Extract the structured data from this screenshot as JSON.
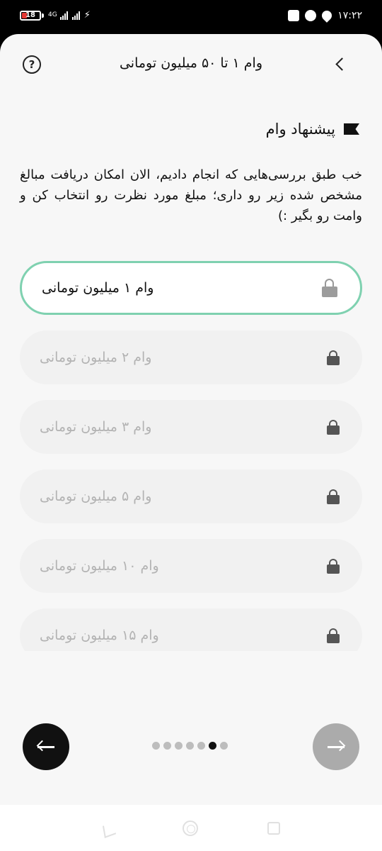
{
  "status_bar": {
    "battery": "18",
    "network": "4G",
    "time": "۱۷:۲۲"
  },
  "header": {
    "title": "وام ۱ تا ۵۰ میلیون تومانی"
  },
  "section": {
    "title": "پیشنهاد وام",
    "description": "خب طبق بررسی‌هایی که انجام دادیم، الان امکان دریافت مبالغ مشخص شده زیر رو داری؛ مبلغ مورد نظرت رو انتخاب کن و وامت رو بگیر :)"
  },
  "loan_options": [
    {
      "label": "وام ۱ میلیون تومانی",
      "selected": true,
      "locked": false
    },
    {
      "label": "وام ۲ میلیون تومانی",
      "selected": false,
      "locked": true
    },
    {
      "label": "وام ۳ میلیون تومانی",
      "selected": false,
      "locked": true
    },
    {
      "label": "وام ۵ میلیون تومانی",
      "selected": false,
      "locked": true
    },
    {
      "label": "وام ۱۰ میلیون تومانی",
      "selected": false,
      "locked": true
    },
    {
      "label": "وام ۱۵ میلیون تومانی",
      "selected": false,
      "locked": true
    }
  ],
  "pagination": {
    "total": 7,
    "current": 6
  },
  "colors": {
    "selected_border": "#7fd1b0",
    "primary_dark": "#111111",
    "disabled_button": "#ababab"
  },
  "icons": {
    "help": "?"
  }
}
